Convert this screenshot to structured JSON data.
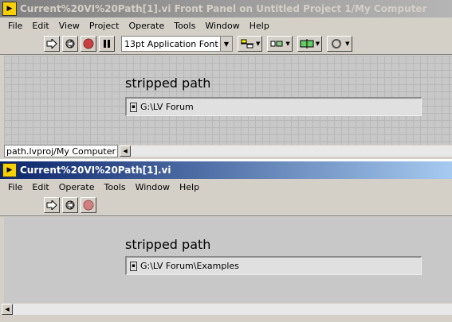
{
  "window1": {
    "title": "Current%20VI%20Path[1].vi Front Panel on Untitled Project 1/My Computer",
    "menus": [
      "File",
      "Edit",
      "View",
      "Project",
      "Operate",
      "Tools",
      "Window",
      "Help"
    ],
    "font_selector": "13pt Application Font",
    "control_label": "stripped path",
    "path_value": "G:\\LV Forum",
    "context": "path.lvproj/My Computer"
  },
  "window2": {
    "title": "Current%20VI%20Path[1].vi",
    "menus": [
      "File",
      "Edit",
      "Operate",
      "Tools",
      "Window",
      "Help"
    ],
    "control_label": "stripped path",
    "path_value": "G:\\LV Forum\\Examples"
  },
  "colors": {
    "active_title": "#0a246a",
    "inactive_title": "#808080",
    "panel_bg": "#c8c8c8"
  }
}
